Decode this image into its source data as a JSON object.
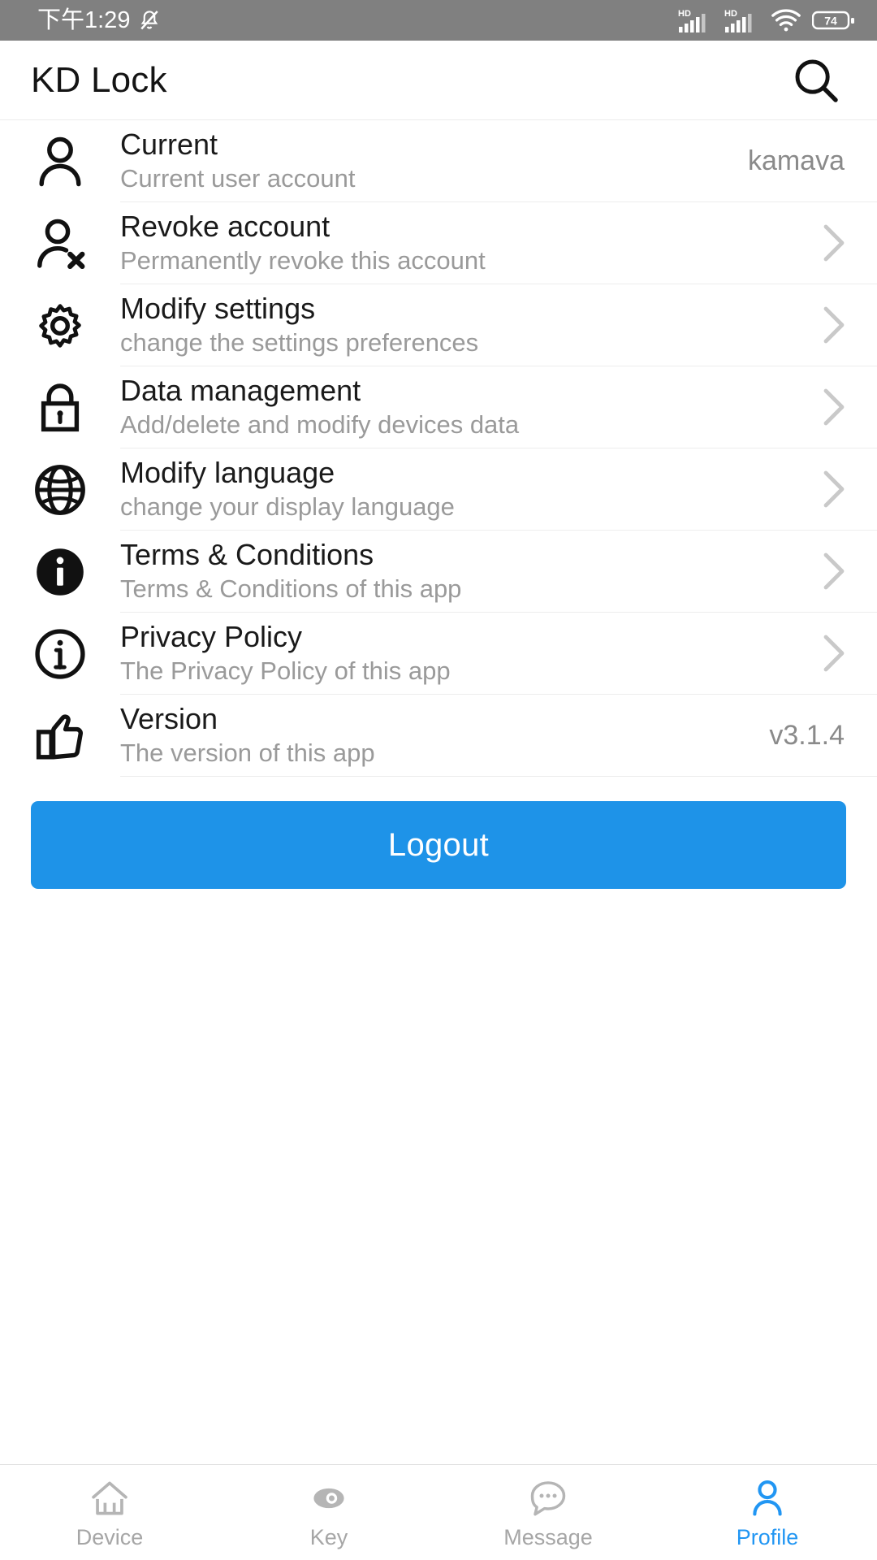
{
  "status_bar": {
    "time": "下午1:29",
    "mute_icon": "bell-muted-icon",
    "signal_1": {
      "icon": "signal-bars-icon",
      "label": "HD"
    },
    "signal_2": {
      "icon": "signal-bars-icon",
      "label": "HD"
    },
    "wifi_icon": "wifi-icon",
    "battery": {
      "icon": "battery-icon",
      "level": "74"
    },
    "background": "#808080"
  },
  "app_bar": {
    "title": "KD Lock",
    "search_icon": "search-icon"
  },
  "list": {
    "items": [
      {
        "icon": "person-icon",
        "title": "Current",
        "subtitle": "Current user account",
        "value": "kamava",
        "accessory": "value"
      },
      {
        "icon": "person-remove-icon",
        "title": "Revoke account",
        "subtitle": "Permanently revoke this account",
        "value": "",
        "accessory": "chevron"
      },
      {
        "icon": "gear-icon",
        "title": "Modify settings",
        "subtitle": "change the settings preferences",
        "value": "",
        "accessory": "chevron"
      },
      {
        "icon": "lock-icon",
        "title": "Data management",
        "subtitle": "Add/delete and modify devices data",
        "value": "",
        "accessory": "chevron"
      },
      {
        "icon": "globe-icon",
        "title": "Modify language",
        "subtitle": "change your display language",
        "value": "",
        "accessory": "chevron"
      },
      {
        "icon": "info-filled-icon",
        "title": "Terms & Conditions",
        "subtitle": "Terms & Conditions of this app",
        "value": "",
        "accessory": "chevron"
      },
      {
        "icon": "info-outline-icon",
        "title": "Privacy Policy",
        "subtitle": "The Privacy Policy of this app",
        "value": "",
        "accessory": "chevron"
      },
      {
        "icon": "thumbs-up-icon",
        "title": "Version",
        "subtitle": "The version of this app",
        "value": "v3.1.4",
        "accessory": "value"
      }
    ]
  },
  "logout": {
    "label": "Logout",
    "color": "#1E93E8"
  },
  "bottom_nav": {
    "active_color": "#2196F3",
    "inactive_color": "#a6a6a6",
    "items": [
      {
        "icon": "home-icon",
        "label": "Device",
        "active": false
      },
      {
        "icon": "key-icon",
        "label": "Key",
        "active": false
      },
      {
        "icon": "message-icon",
        "label": "Message",
        "active": false
      },
      {
        "icon": "profile-icon",
        "label": "Profile",
        "active": true
      }
    ]
  }
}
